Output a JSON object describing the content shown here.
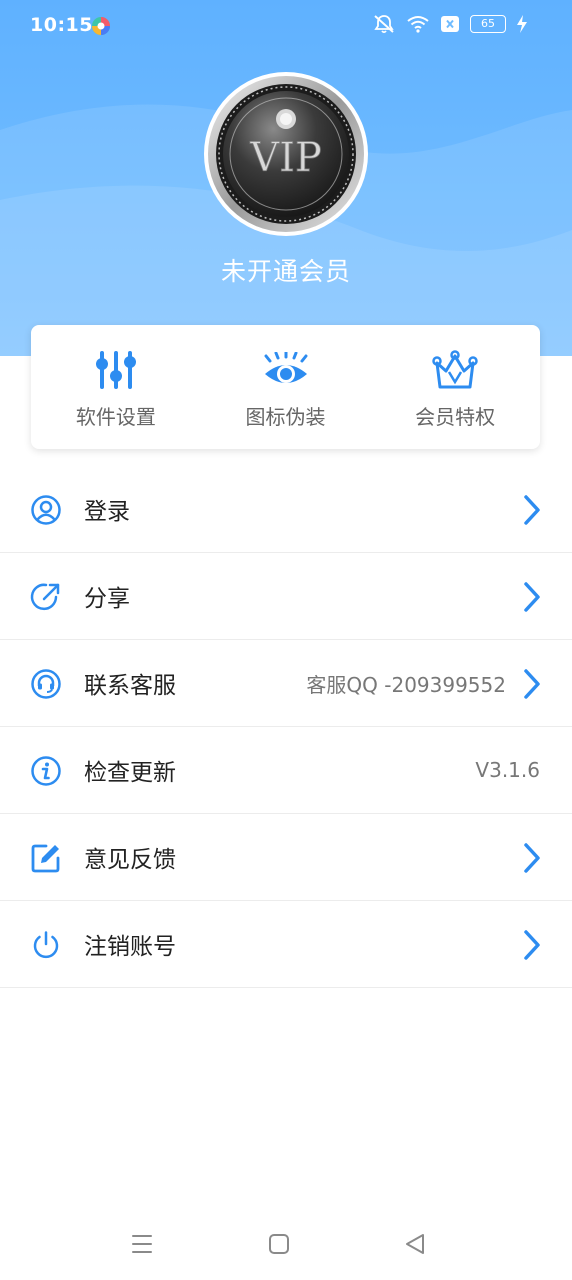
{
  "status_bar": {
    "time": "10:15",
    "battery": "65",
    "icons": [
      "app-logo-icon",
      "mute-icon",
      "wifi-icon",
      "sim-x-icon",
      "battery-icon",
      "charging-icon"
    ]
  },
  "profile": {
    "badge_text": "VIP",
    "member_status": "未开通会员"
  },
  "quick_actions": [
    {
      "label": "软件设置",
      "icon": "sliders-icon"
    },
    {
      "label": "图标伪装",
      "icon": "eye-icon"
    },
    {
      "label": "会员特权",
      "icon": "crown-icon"
    }
  ],
  "menu": [
    {
      "label": "登录",
      "icon": "user-icon",
      "value": "",
      "arrow": true
    },
    {
      "label": "分享",
      "icon": "share-icon",
      "value": "",
      "arrow": true
    },
    {
      "label": "联系客服",
      "icon": "headset-icon",
      "value": "客服QQ -209399552",
      "arrow": true
    },
    {
      "label": "检查更新",
      "icon": "info-icon",
      "value": "V3.1.6",
      "arrow": false
    },
    {
      "label": "意见反馈",
      "icon": "edit-icon",
      "value": "",
      "arrow": true
    },
    {
      "label": "注销账号",
      "icon": "power-icon",
      "value": "",
      "arrow": true
    }
  ],
  "colors": {
    "accent": "#2d8cf0",
    "header_top": "#5fb1ff",
    "header_bottom": "#7cc2ff"
  },
  "nav_bar": [
    "menu-icon",
    "home-icon",
    "back-icon"
  ]
}
